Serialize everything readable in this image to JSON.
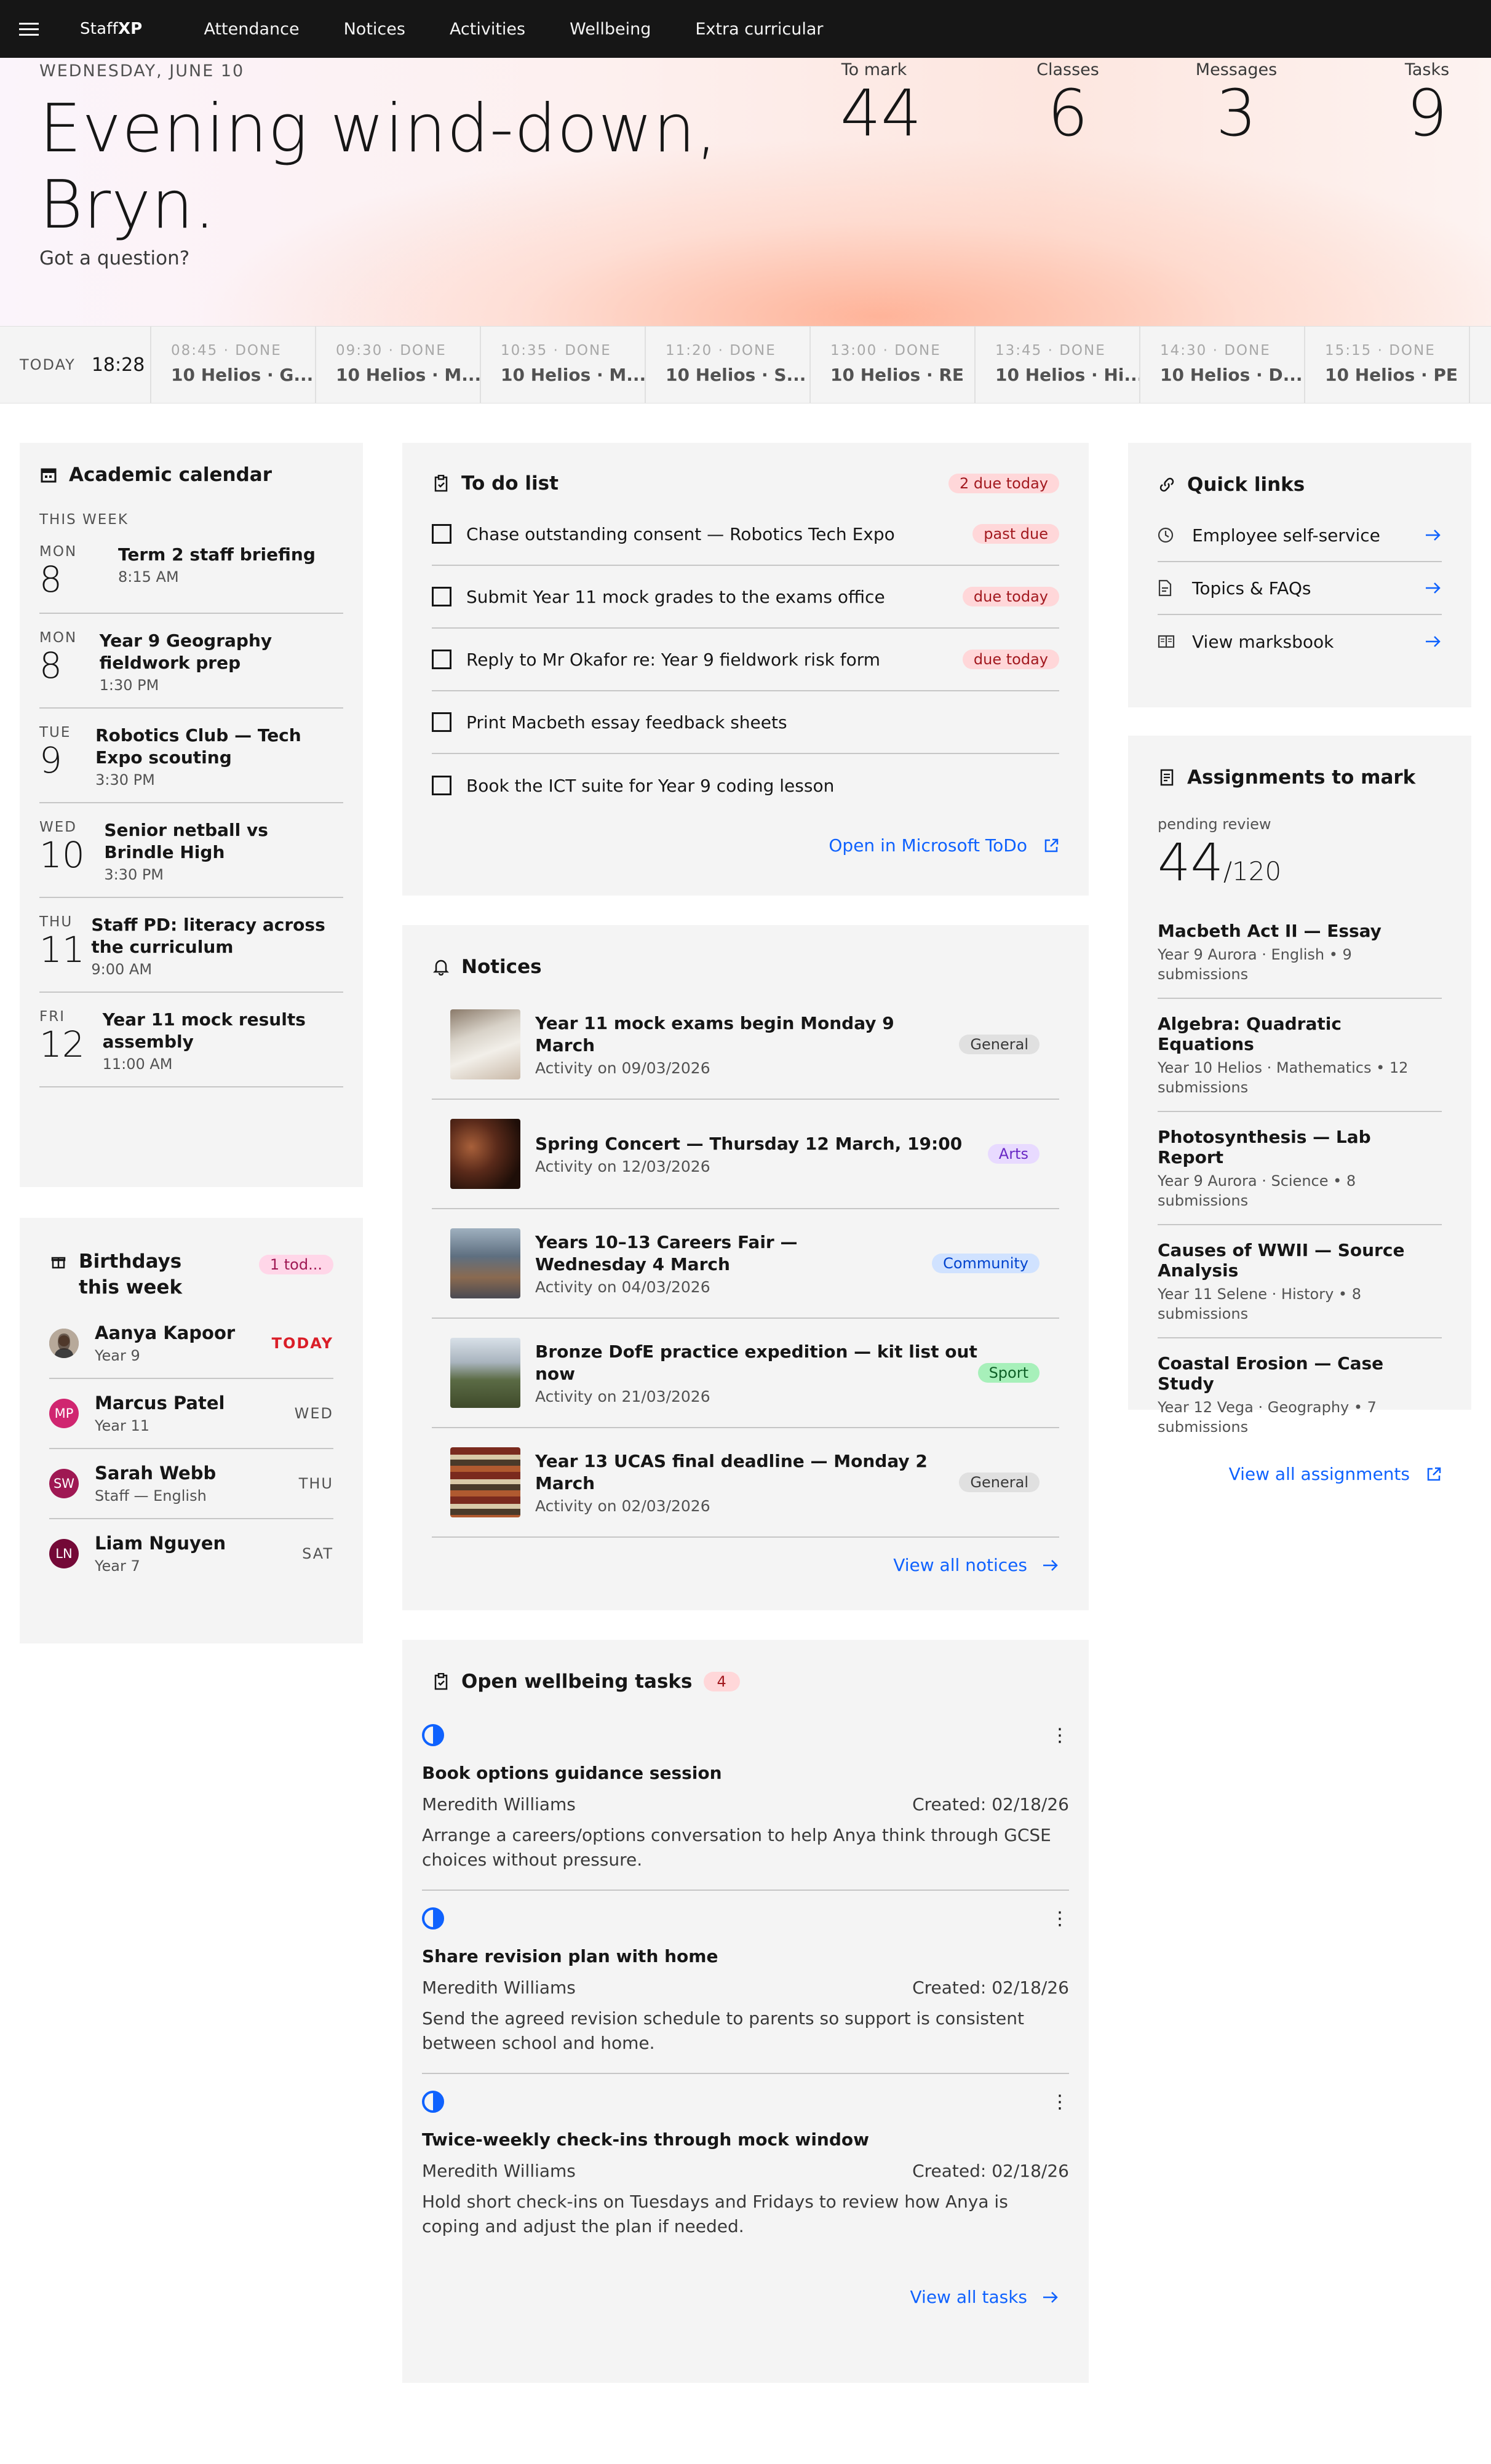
{
  "nav": {
    "brand_prefix": "Staff",
    "brand_bold": "XP",
    "items": [
      "Attendance",
      "Notices",
      "Activities",
      "Wellbeing",
      "Extra curricular"
    ]
  },
  "hero": {
    "date": "WEDNESDAY, JUNE 10",
    "greeting_line1": "Evening wind-down,",
    "greeting_line2": "Bryn.",
    "question_link": "Got a question?",
    "stats": [
      {
        "label": "To mark",
        "value": "44"
      },
      {
        "label": "Classes",
        "value": "6"
      },
      {
        "label": "Messages",
        "value": "3"
      },
      {
        "label": "Tasks",
        "value": "9"
      }
    ]
  },
  "schedule": {
    "today_label": "TODAY",
    "current_time": "18:28",
    "slots": [
      {
        "status": "08:45 · DONE",
        "class": "10 Helios · G..."
      },
      {
        "status": "09:30 · DONE",
        "class": "10 Helios · M..."
      },
      {
        "status": "10:35 · DONE",
        "class": "10 Helios · M..."
      },
      {
        "status": "11:20 · DONE",
        "class": "10 Helios · S..."
      },
      {
        "status": "13:00 · DONE",
        "class": "10 Helios · RE"
      },
      {
        "status": "13:45 · DONE",
        "class": "10 Helios · Hi..."
      },
      {
        "status": "14:30 · DONE",
        "class": "10 Helios · D..."
      },
      {
        "status": "15:15 · DONE",
        "class": "10 Helios · PE"
      }
    ]
  },
  "calendar": {
    "title": "Academic calendar",
    "week_label": "THIS WEEK",
    "events": [
      {
        "dow": "MON",
        "day": "8",
        "title": "Term 2 staff briefing",
        "time": "8:15 AM"
      },
      {
        "dow": "MON",
        "day": "8",
        "title": "Year 9 Geography fieldwork prep",
        "time": "1:30 PM"
      },
      {
        "dow": "TUE",
        "day": "9",
        "title": "Robotics Club — Tech Expo scouting",
        "time": "3:30 PM"
      },
      {
        "dow": "WED",
        "day": "10",
        "title": "Senior netball vs Brindle High",
        "time": "3:30 PM"
      },
      {
        "dow": "THU",
        "day": "11",
        "title": "Staff PD: literacy across the curriculum",
        "time": "9:00 AM"
      },
      {
        "dow": "FRI",
        "day": "12",
        "title": "Year 11 mock results assembly",
        "time": "11:00 AM"
      }
    ]
  },
  "birthdays": {
    "title": "Birthdays this week",
    "badge": "1 tod...",
    "people": [
      {
        "initials": "",
        "name": "Aanya Kapoor",
        "sub": "Year 9",
        "when": "TODAY",
        "color": "#8d8d8d"
      },
      {
        "initials": "MP",
        "name": "Marcus Patel",
        "sub": "Year 11",
        "when": "WED",
        "color": "#d02670"
      },
      {
        "initials": "SW",
        "name": "Sarah Webb",
        "sub": "Staff — English",
        "when": "THU",
        "color": "#9f1853"
      },
      {
        "initials": "LN",
        "name": "Liam Nguyen",
        "sub": "Year 7",
        "when": "SAT",
        "color": "#740937"
      }
    ]
  },
  "todo": {
    "title": "To do list",
    "badge": "2 due today",
    "items": [
      {
        "text": "Chase outstanding consent — Robotics Tech Expo",
        "tag": "past due"
      },
      {
        "text": "Submit Year 11 mock grades to the exams office",
        "tag": "due today"
      },
      {
        "text": "Reply to Mr Okafor re: Year 9 fieldwork risk form",
        "tag": "due today"
      },
      {
        "text": "Print Macbeth essay feedback sheets",
        "tag": ""
      },
      {
        "text": "Book the ICT suite for Year 9 coding lesson",
        "tag": ""
      }
    ],
    "open_link": "Open in Microsoft ToDo"
  },
  "notices": {
    "title": "Notices",
    "items": [
      {
        "title": "Year 11 mock exams begin Monday 9 March",
        "sub": "Activity on 09/03/2026",
        "tag": "General",
        "tag_style": "gray",
        "thumb": "exam-papers"
      },
      {
        "title": "Spring Concert — Thursday 12 March, 19:00",
        "sub": "Activity on 12/03/2026",
        "tag": "Arts",
        "tag_style": "purple",
        "thumb": "orchestra"
      },
      {
        "title": "Years 10–13 Careers Fair — Wednesday 4 March",
        "sub": "Activity on 04/03/2026",
        "tag": "Community",
        "tag_style": "blue",
        "thumb": "fair-crowd"
      },
      {
        "title": "Bronze DofE practice expedition — kit list out now",
        "sub": "Activity on 21/03/2026",
        "tag": "Sport",
        "tag_style": "green",
        "thumb": "mountains"
      },
      {
        "title": "Year 13 UCAS final deadline — Monday 2 March",
        "sub": "Activity on 02/03/2026",
        "tag": "General",
        "tag_style": "gray",
        "thumb": "books"
      }
    ],
    "view_all": "View all notices"
  },
  "wellbeing": {
    "title": "Open wellbeing tasks",
    "count": "4",
    "tasks": [
      {
        "title": "Book options guidance session",
        "owner": "Meredith Williams",
        "created": "Created: 02/18/26",
        "desc": "Arrange a careers/options conversation to help Anya think through GCSE choices without pressure."
      },
      {
        "title": "Share revision plan with home",
        "owner": "Meredith Williams",
        "created": "Created: 02/18/26",
        "desc": "Send the agreed revision schedule to parents so support is consistent between school and home."
      },
      {
        "title": "Twice-weekly check-ins through mock window",
        "owner": "Meredith Williams",
        "created": "Created: 02/18/26",
        "desc": "Hold short check-ins on Tuesdays and Fridays to review how Anya is coping and adjust the plan if needed."
      }
    ],
    "view_all": "View all tasks"
  },
  "quick_links": {
    "title": "Quick links",
    "items": [
      {
        "label": "Employee self-service",
        "icon": "clock-icon"
      },
      {
        "label": "Topics & FAQs",
        "icon": "document-icon"
      },
      {
        "label": "View marksbook",
        "icon": "book-icon"
      }
    ]
  },
  "assignments": {
    "title": "Assignments to mark",
    "pending_label": "pending review",
    "pending": "44",
    "total": "/120",
    "items": [
      {
        "title": "Macbeth Act II — Essay",
        "sub": "Year 9 Aurora · English • 9 submissions"
      },
      {
        "title": "Algebra: Quadratic Equations",
        "sub": "Year 10 Helios · Mathematics • 12 submissions"
      },
      {
        "title": "Photosynthesis — Lab Report",
        "sub": "Year 9 Aurora · Science • 8 submissions"
      },
      {
        "title": "Causes of WWII — Source Analysis",
        "sub": "Year 11 Selene · History • 8 submissions"
      },
      {
        "title": "Coastal Erosion — Case Study",
        "sub": "Year 12 Vega · Geography • 7 submissions"
      }
    ],
    "view_all": "View all assignments"
  }
}
